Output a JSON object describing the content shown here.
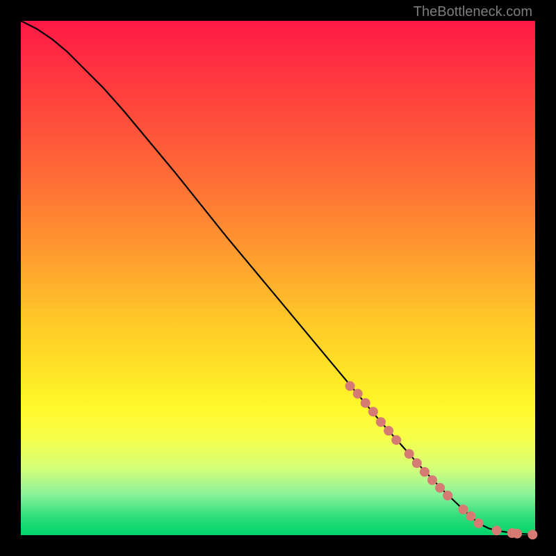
{
  "watermark": "TheBottleneck.com",
  "chart_data": {
    "type": "line",
    "title": "",
    "xlabel": "",
    "ylabel": "",
    "xlim": [
      0,
      100
    ],
    "ylim": [
      0,
      100
    ],
    "grid": false,
    "legend": false,
    "curve": {
      "name": "bottleneck-curve",
      "description": "Monotone decreasing curve from top-left to bottom-right, flattening near zero at the right edge",
      "x": [
        0,
        3,
        6,
        9,
        12,
        16,
        20,
        30,
        40,
        50,
        60,
        65,
        70,
        74,
        78,
        82,
        86,
        89,
        91,
        93,
        95,
        97,
        99,
        100
      ],
      "y": [
        100,
        98.5,
        96.5,
        94.0,
        91.0,
        87.0,
        82.5,
        70.5,
        58.0,
        46.0,
        34.0,
        28.0,
        22.0,
        17.5,
        13.0,
        8.8,
        5.0,
        2.3,
        1.3,
        0.8,
        0.5,
        0.3,
        0.15,
        0.1
      ]
    },
    "markers": {
      "name": "highlighted-segment",
      "color": "#d67b73",
      "radius": 7,
      "points": [
        {
          "x": 64.0,
          "y": 29.0
        },
        {
          "x": 65.5,
          "y": 27.5
        },
        {
          "x": 67.0,
          "y": 25.7
        },
        {
          "x": 68.5,
          "y": 24.0
        },
        {
          "x": 70.0,
          "y": 22.0
        },
        {
          "x": 71.5,
          "y": 20.3
        },
        {
          "x": 73.0,
          "y": 18.5
        },
        {
          "x": 75.5,
          "y": 15.8
        },
        {
          "x": 77.0,
          "y": 14.0
        },
        {
          "x": 78.5,
          "y": 12.3
        },
        {
          "x": 80.0,
          "y": 10.7
        },
        {
          "x": 81.5,
          "y": 9.2
        },
        {
          "x": 83.0,
          "y": 7.7
        },
        {
          "x": 86.0,
          "y": 5.0
        },
        {
          "x": 87.5,
          "y": 3.7
        },
        {
          "x": 89.0,
          "y": 2.3
        },
        {
          "x": 92.5,
          "y": 0.9
        },
        {
          "x": 95.5,
          "y": 0.4
        },
        {
          "x": 96.5,
          "y": 0.3
        },
        {
          "x": 99.5,
          "y": 0.1
        }
      ]
    }
  }
}
